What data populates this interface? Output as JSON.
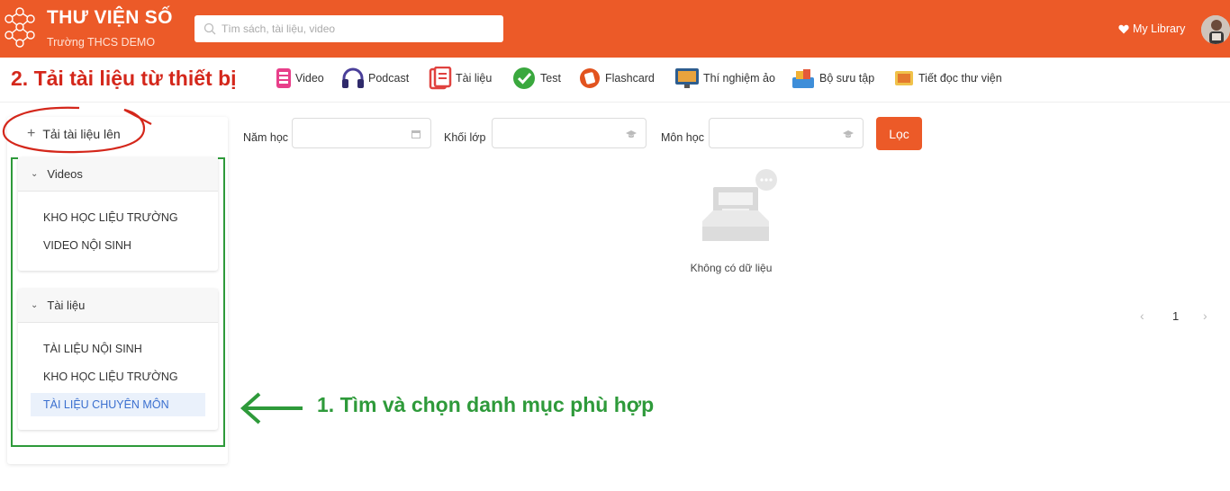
{
  "header": {
    "brand_title": "THƯ VIỆN SỐ",
    "brand_subtitle": "Trường THCS DEMO",
    "search_placeholder": "Tìm sách, tài liệu, video",
    "my_library": "My Library",
    "accent_color": "#ec5a28"
  },
  "annotations": {
    "step2": "2. Tải tài liệu từ thiết bị",
    "step1": "1. Tìm và chọn danh mục phù hợp",
    "step2_color": "#d4271b",
    "step1_color": "#2e9a3a"
  },
  "nav": [
    {
      "label": "Video",
      "icon": "video-icon"
    },
    {
      "label": "Podcast",
      "icon": "headphones-icon"
    },
    {
      "label": "Tài liệu",
      "icon": "document-icon"
    },
    {
      "label": "Test",
      "icon": "test-check-icon"
    },
    {
      "label": "Flashcard",
      "icon": "flashcard-icon"
    },
    {
      "label": "Thí nghiệm ảo",
      "icon": "monitor-icon"
    },
    {
      "label": "Bộ sưu tập",
      "icon": "collection-icon"
    },
    {
      "label": "Tiết đọc thư viện",
      "icon": "reading-icon"
    }
  ],
  "sidebar": {
    "upload_label": "Tải tài liệu lên",
    "groups": [
      {
        "title": "Videos",
        "items": [
          "KHO HỌC LIỆU TRƯỜNG",
          "VIDEO NỘI SINH"
        ]
      },
      {
        "title": "Tài liệu",
        "items": [
          "TÀI LIỆU NỘI SINH",
          "KHO HỌC LIỆU TRƯỜNG",
          "TÀI LIỆU CHUYÊN MÔN"
        ],
        "active": "TÀI LIỆU CHUYÊN MÔN"
      }
    ]
  },
  "filters": {
    "year_label": "Năm học",
    "grade_label": "Khối lớp",
    "subject_label": "Môn học",
    "filter_button": "Lọc"
  },
  "empty_text": "Không có dữ liệu",
  "pagination": {
    "current_page": "1",
    "prev": "‹",
    "next": "›"
  }
}
